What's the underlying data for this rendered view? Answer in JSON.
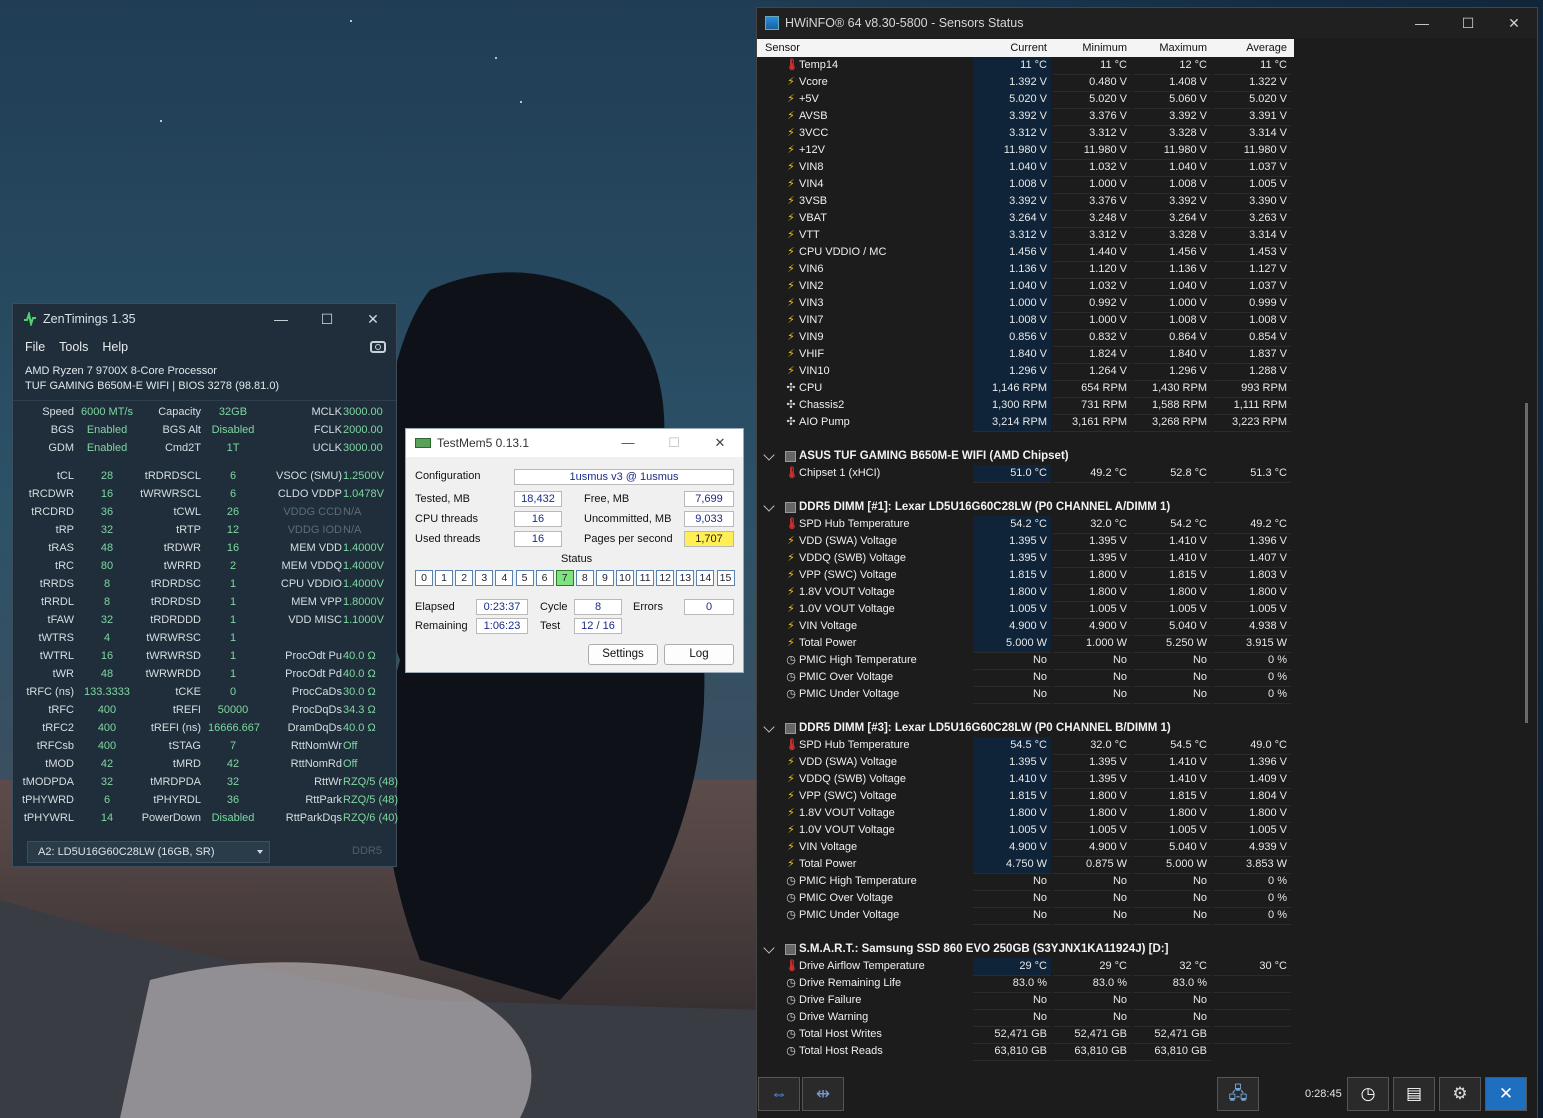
{
  "zentimings": {
    "title": "ZenTimings 1.35",
    "menu": [
      "File",
      "Tools",
      "Help"
    ],
    "cpu": "AMD Ryzen 7 9700X 8-Core Processor",
    "board": "TUF GAMING B650M-E WIFI | BIOS 3278 (98.81.0)",
    "rows": [
      [
        "Speed",
        "6000 MT/s",
        "Capacity",
        "32GB",
        "MCLK",
        "3000.00"
      ],
      [
        "BGS",
        "Enabled",
        "BGS Alt",
        "Disabled",
        "FCLK",
        "2000.00"
      ],
      [
        "GDM",
        "Enabled",
        "Cmd2T",
        "1T",
        "UCLK",
        "3000.00"
      ],
      [
        "tCL",
        "28",
        "tRDRDSCL",
        "6",
        "VSOC (SMU)",
        "1.2500V"
      ],
      [
        "tRCDWR",
        "16",
        "tWRWRSCL",
        "6",
        "CLDO VDDP",
        "1.0478V"
      ],
      [
        "tRCDRD",
        "36",
        "tCWL",
        "26",
        "VDDG CCD",
        "N/A"
      ],
      [
        "tRP",
        "32",
        "tRTP",
        "12",
        "VDDG IOD",
        "N/A"
      ],
      [
        "tRAS",
        "48",
        "tRDWR",
        "16",
        "MEM VDD",
        "1.4000V"
      ],
      [
        "tRC",
        "80",
        "tWRRD",
        "2",
        "MEM VDDQ",
        "1.4000V"
      ],
      [
        "tRRDS",
        "8",
        "tRDRDSC",
        "1",
        "CPU VDDIO",
        "1.4000V"
      ],
      [
        "tRRDL",
        "8",
        "tRDRDSD",
        "1",
        "MEM VPP",
        "1.8000V"
      ],
      [
        "tFAW",
        "32",
        "tRDRDDD",
        "1",
        "VDD MISC",
        "1.1000V"
      ],
      [
        "tWTRS",
        "4",
        "tWRWRSC",
        "1",
        "",
        ""
      ],
      [
        "tWTRL",
        "16",
        "tWRWRSD",
        "1",
        "ProcOdt Pu",
        "40.0 Ω"
      ],
      [
        "tWR",
        "48",
        "tWRWRDD",
        "1",
        "ProcOdt Pd",
        "40.0 Ω"
      ],
      [
        "tRFC (ns)",
        "133.3333",
        "tCKE",
        "0",
        "ProcCaDs",
        "30.0 Ω"
      ],
      [
        "tRFC",
        "400",
        "tREFI",
        "50000",
        "ProcDqDs",
        "34.3 Ω"
      ],
      [
        "tRFC2",
        "400",
        "tREFI (ns)",
        "16666.667",
        "DramDqDs",
        "40.0 Ω"
      ],
      [
        "tRFCsb",
        "400",
        "tSTAG",
        "7",
        "RttNomWr",
        "Off"
      ],
      [
        "tMOD",
        "42",
        "tMRD",
        "42",
        "RttNomRd",
        "Off"
      ],
      [
        "tMODPDA",
        "32",
        "tMRDPDA",
        "32",
        "RttWr",
        "RZQ/5 (48)"
      ],
      [
        "tPHYWRD",
        "6",
        "tPHYRDL",
        "36",
        "RttPark",
        "RZQ/5 (48)"
      ],
      [
        "tPHYWRL",
        "14",
        "PowerDown",
        "Disabled",
        "RttParkDqs",
        "RZQ/6 (40)"
      ]
    ],
    "dimm_select": "A2: LD5U16G60C28LW (16GB, SR)",
    "ddr_type": "DDR5",
    "value_color": "#7fd6a0"
  },
  "testmem": {
    "title": "TestMem5  0.13.1",
    "config_label": "Configuration",
    "config_value": "1usmus v3 @ 1usmus",
    "tested_label": "Tested, MB",
    "tested_value": "18,432",
    "free_label": "Free, MB",
    "free_value": "7,699",
    "threads_label": "CPU threads",
    "threads_value": "16",
    "uncommitted_label": "Uncommitted, MB",
    "uncommitted_value": "9,033",
    "used_label": "Used threads",
    "used_value": "16",
    "pages_label": "Pages per second",
    "pages_value": "1,707",
    "status_label": "Status",
    "status_cells": [
      "0",
      "1",
      "2",
      "3",
      "4",
      "5",
      "6",
      "7",
      "8",
      "9",
      "10",
      "11",
      "12",
      "13",
      "14",
      "15"
    ],
    "active_cell": "7",
    "elapsed_label": "Elapsed",
    "elapsed_value": "0:23:37",
    "cycle_label": "Cycle",
    "cycle_value": "8",
    "errors_label": "Errors",
    "errors_value": "0",
    "remaining_label": "Remaining",
    "remaining_value": "1:06:23",
    "test_label": "Test",
    "test_value": "12 / 16",
    "settings_btn": "Settings",
    "log_btn": "Log"
  },
  "hwinfo": {
    "title": "HWiNFO® 64 v8.30-5800 - Sensors Status",
    "columns": [
      "Sensor",
      "Current",
      "Minimum",
      "Maximum",
      "Average"
    ],
    "entries": [
      {
        "n": "Temp14",
        "i": "therm",
        "v": [
          "11 °C",
          "11 °C",
          "12 °C",
          "11 °C"
        ]
      },
      {
        "n": "Vcore",
        "i": "volt",
        "v": [
          "1.392 V",
          "0.480 V",
          "1.408 V",
          "1.322 V"
        ]
      },
      {
        "n": "+5V",
        "i": "volt",
        "v": [
          "5.020 V",
          "5.020 V",
          "5.060 V",
          "5.020 V"
        ]
      },
      {
        "n": "AVSB",
        "i": "volt",
        "v": [
          "3.392 V",
          "3.376 V",
          "3.392 V",
          "3.391 V"
        ]
      },
      {
        "n": "3VCC",
        "i": "volt",
        "v": [
          "3.312 V",
          "3.312 V",
          "3.328 V",
          "3.314 V"
        ]
      },
      {
        "n": "+12V",
        "i": "volt",
        "v": [
          "11.980 V",
          "11.980 V",
          "11.980 V",
          "11.980 V"
        ]
      },
      {
        "n": "VIN8",
        "i": "volt",
        "v": [
          "1.040 V",
          "1.032 V",
          "1.040 V",
          "1.037 V"
        ]
      },
      {
        "n": "VIN4",
        "i": "volt",
        "v": [
          "1.008 V",
          "1.000 V",
          "1.008 V",
          "1.005 V"
        ]
      },
      {
        "n": "3VSB",
        "i": "volt",
        "v": [
          "3.392 V",
          "3.376 V",
          "3.392 V",
          "3.390 V"
        ]
      },
      {
        "n": "VBAT",
        "i": "volt",
        "v": [
          "3.264 V",
          "3.248 V",
          "3.264 V",
          "3.263 V"
        ]
      },
      {
        "n": "VTT",
        "i": "volt",
        "v": [
          "3.312 V",
          "3.312 V",
          "3.328 V",
          "3.314 V"
        ]
      },
      {
        "n": "CPU VDDIO / MC",
        "i": "volt",
        "v": [
          "1.456 V",
          "1.440 V",
          "1.456 V",
          "1.453 V"
        ]
      },
      {
        "n": "VIN6",
        "i": "volt",
        "v": [
          "1.136 V",
          "1.120 V",
          "1.136 V",
          "1.127 V"
        ]
      },
      {
        "n": "VIN2",
        "i": "volt",
        "v": [
          "1.040 V",
          "1.032 V",
          "1.040 V",
          "1.037 V"
        ]
      },
      {
        "n": "VIN3",
        "i": "volt",
        "v": [
          "1.000 V",
          "0.992 V",
          "1.000 V",
          "0.999 V"
        ]
      },
      {
        "n": "VIN7",
        "i": "volt",
        "v": [
          "1.008 V",
          "1.000 V",
          "1.008 V",
          "1.008 V"
        ]
      },
      {
        "n": "VIN9",
        "i": "volt",
        "v": [
          "0.856 V",
          "0.832 V",
          "0.864 V",
          "0.854 V"
        ]
      },
      {
        "n": "VHIF",
        "i": "volt",
        "v": [
          "1.840 V",
          "1.824 V",
          "1.840 V",
          "1.837 V"
        ]
      },
      {
        "n": "VIN10",
        "i": "volt",
        "v": [
          "1.296 V",
          "1.264 V",
          "1.296 V",
          "1.288 V"
        ]
      },
      {
        "n": "CPU",
        "i": "fan",
        "v": [
          "1,146 RPM",
          "654 RPM",
          "1,430 RPM",
          "993 RPM"
        ]
      },
      {
        "n": "Chassis2",
        "i": "fan",
        "v": [
          "1,300 RPM",
          "731 RPM",
          "1,588 RPM",
          "1,111 RPM"
        ]
      },
      {
        "n": "AIO Pump",
        "i": "fan",
        "v": [
          "3,214 RPM",
          "3,161 RPM",
          "3,268 RPM",
          "3,223 RPM"
        ]
      },
      {
        "gap": true
      },
      {
        "g": "ASUS TUF GAMING B650M-E WIFI (AMD Chipset)"
      },
      {
        "n": "Chipset 1 (xHCI)",
        "i": "therm",
        "v": [
          "51.0 °C",
          "49.2 °C",
          "52.8 °C",
          "51.3 °C"
        ]
      },
      {
        "gap": true
      },
      {
        "g": "DDR5 DIMM [#1]: Lexar LD5U16G60C28LW (P0 CHANNEL A/DIMM 1)"
      },
      {
        "n": "SPD Hub Temperature",
        "i": "therm",
        "v": [
          "54.2 °C",
          "32.0 °C",
          "54.2 °C",
          "49.2 °C"
        ]
      },
      {
        "n": "VDD (SWA) Voltage",
        "i": "volt",
        "v": [
          "1.395 V",
          "1.395 V",
          "1.410 V",
          "1.396 V"
        ]
      },
      {
        "n": "VDDQ (SWB) Voltage",
        "i": "volt",
        "v": [
          "1.395 V",
          "1.395 V",
          "1.410 V",
          "1.407 V"
        ]
      },
      {
        "n": "VPP (SWC) Voltage",
        "i": "volt",
        "v": [
          "1.815 V",
          "1.800 V",
          "1.815 V",
          "1.803 V"
        ]
      },
      {
        "n": "1.8V VOUT Voltage",
        "i": "volt",
        "v": [
          "1.800 V",
          "1.800 V",
          "1.800 V",
          "1.800 V"
        ]
      },
      {
        "n": "1.0V VOUT Voltage",
        "i": "volt",
        "v": [
          "1.005 V",
          "1.005 V",
          "1.005 V",
          "1.005 V"
        ]
      },
      {
        "n": "VIN Voltage",
        "i": "volt",
        "v": [
          "4.900 V",
          "4.900 V",
          "5.040 V",
          "4.938 V"
        ]
      },
      {
        "n": "Total Power",
        "i": "volt",
        "v": [
          "5.000 W",
          "1.000 W",
          "5.250 W",
          "3.915 W"
        ]
      },
      {
        "n": "PMIC High Temperature",
        "i": "clock",
        "v": [
          "No",
          "No",
          "No",
          "0 %"
        ]
      },
      {
        "n": "PMIC Over Voltage",
        "i": "clock",
        "v": [
          "No",
          "No",
          "No",
          "0 %"
        ]
      },
      {
        "n": "PMIC Under Voltage",
        "i": "clock",
        "v": [
          "No",
          "No",
          "No",
          "0 %"
        ]
      },
      {
        "gap": true
      },
      {
        "g": "DDR5 DIMM [#3]: Lexar LD5U16G60C28LW (P0 CHANNEL B/DIMM 1)"
      },
      {
        "n": "SPD Hub Temperature",
        "i": "therm",
        "v": [
          "54.5 °C",
          "32.0 °C",
          "54.5 °C",
          "49.0 °C"
        ]
      },
      {
        "n": "VDD (SWA) Voltage",
        "i": "volt",
        "v": [
          "1.395 V",
          "1.395 V",
          "1.410 V",
          "1.396 V"
        ]
      },
      {
        "n": "VDDQ (SWB) Voltage",
        "i": "volt",
        "v": [
          "1.410 V",
          "1.395 V",
          "1.410 V",
          "1.409 V"
        ]
      },
      {
        "n": "VPP (SWC) Voltage",
        "i": "volt",
        "v": [
          "1.815 V",
          "1.800 V",
          "1.815 V",
          "1.804 V"
        ]
      },
      {
        "n": "1.8V VOUT Voltage",
        "i": "volt",
        "v": [
          "1.800 V",
          "1.800 V",
          "1.800 V",
          "1.800 V"
        ]
      },
      {
        "n": "1.0V VOUT Voltage",
        "i": "volt",
        "v": [
          "1.005 V",
          "1.005 V",
          "1.005 V",
          "1.005 V"
        ]
      },
      {
        "n": "VIN Voltage",
        "i": "volt",
        "v": [
          "4.900 V",
          "4.900 V",
          "5.040 V",
          "4.939 V"
        ]
      },
      {
        "n": "Total Power",
        "i": "volt",
        "v": [
          "4.750 W",
          "0.875 W",
          "5.000 W",
          "3.853 W"
        ]
      },
      {
        "n": "PMIC High Temperature",
        "i": "clock",
        "v": [
          "No",
          "No",
          "No",
          "0 %"
        ]
      },
      {
        "n": "PMIC Over Voltage",
        "i": "clock",
        "v": [
          "No",
          "No",
          "No",
          "0 %"
        ]
      },
      {
        "n": "PMIC Under Voltage",
        "i": "clock",
        "v": [
          "No",
          "No",
          "No",
          "0 %"
        ]
      },
      {
        "gap": true
      },
      {
        "g": "S.M.A.R.T.: Samsung SSD 860 EVO 250GB (S3YJNX1KA11924J) [D:]"
      },
      {
        "n": "Drive Airflow Temperature",
        "i": "therm",
        "v": [
          "29 °C",
          "29 °C",
          "32 °C",
          "30 °C"
        ]
      },
      {
        "n": "Drive Remaining Life",
        "i": "clock",
        "v": [
          "83.0 %",
          "83.0 %",
          "83.0 %",
          ""
        ]
      },
      {
        "n": "Drive Failure",
        "i": "clock",
        "v": [
          "No",
          "No",
          "No",
          ""
        ]
      },
      {
        "n": "Drive Warning",
        "i": "clock",
        "v": [
          "No",
          "No",
          "No",
          ""
        ]
      },
      {
        "n": "Total Host Writes",
        "i": "clock",
        "v": [
          "52,471 GB",
          "52,471 GB",
          "52,471 GB",
          ""
        ]
      },
      {
        "n": "Total Host Reads",
        "i": "clock",
        "v": [
          "63,810 GB",
          "63,810 GB",
          "63,810 GB",
          ""
        ]
      }
    ],
    "footer_time": "0:28:45"
  }
}
